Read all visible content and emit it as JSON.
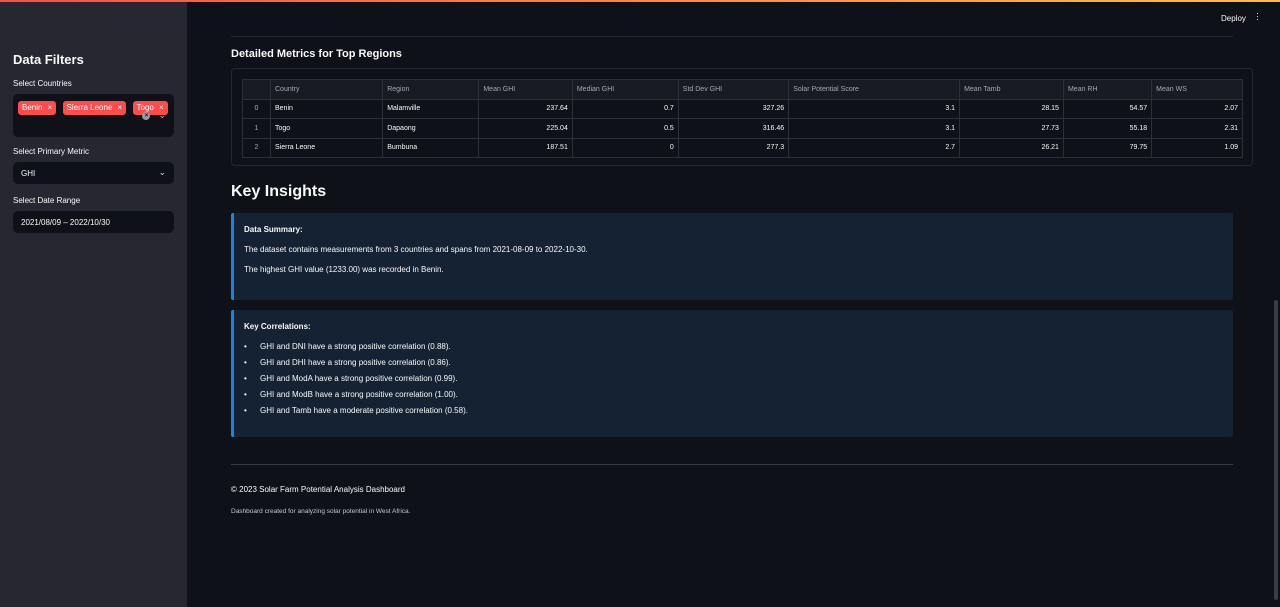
{
  "header": {
    "deploy_label": "Deploy",
    "menu_icon": "vertical-dots-icon"
  },
  "sidebar": {
    "title": "Data Filters",
    "countries_label": "Select Countries",
    "countries": [
      "Benin",
      "Sierra Leone",
      "Togo"
    ],
    "chip_remove": "×",
    "metric_label": "Select Primary Metric",
    "metric_value": "GHI",
    "date_label": "Select Date Range",
    "date_value": "2021/08/09 – 2022/10/30"
  },
  "metrics": {
    "title": "Detailed Metrics for Top Regions",
    "columns": [
      "Country",
      "Region",
      "Mean GHI",
      "Median GHI",
      "Std Dev GHI",
      "Solar Potential Score",
      "Mean Tamb",
      "Mean RH",
      "Mean WS"
    ],
    "rows": [
      {
        "index": "0",
        "cells": [
          "Benin",
          "Malamville",
          "237.64",
          "0.7",
          "327.26",
          "3.1",
          "28.15",
          "54.57",
          "2.07"
        ]
      },
      {
        "index": "1",
        "cells": [
          "Togo",
          "Dapaong",
          "225.04",
          "0.5",
          "316.46",
          "3.1",
          "27.73",
          "55.18",
          "2.31"
        ]
      },
      {
        "index": "2",
        "cells": [
          "Sierra Leone",
          "Bumbuna",
          "187.51",
          "0",
          "277.3",
          "2.7",
          "26.21",
          "79.75",
          "1.09"
        ]
      }
    ]
  },
  "insights": {
    "title": "Key Insights",
    "summary_title": "Data Summary:",
    "summary_line1": "The dataset contains measurements from 3 countries and spans from 2021-08-09 to 2022-10-30.",
    "summary_line2": "The highest GHI value (1233.00) was recorded in Benin.",
    "correlations_title": "Key Correlations:",
    "correlations": [
      "GHI and DNI have a strong positive correlation (0.88).",
      "GHI and DHI have a strong positive correlation (0.86).",
      "GHI and ModA have a strong positive correlation (0.99).",
      "GHI and ModB have a strong positive correlation (1.00).",
      "GHI and Tamb have a moderate positive correlation (0.58)."
    ]
  },
  "footer": {
    "copyright": "© 2023 Solar Farm Potential Analysis Dashboard",
    "credit": "Dashboard created for analyzing solar potential in West Africa."
  }
}
